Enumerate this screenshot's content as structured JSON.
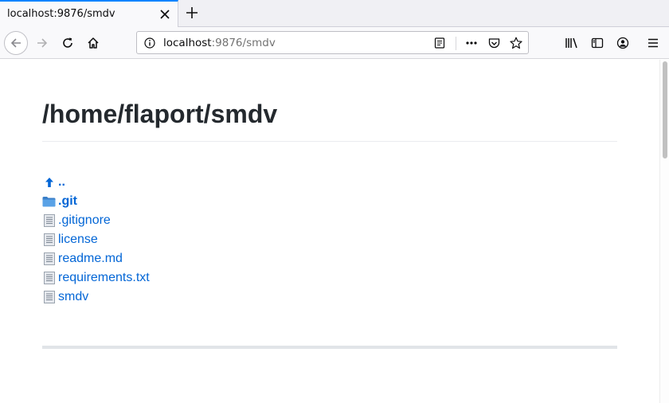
{
  "browser": {
    "tab": {
      "title": "localhost:9876/smdv",
      "close_icon": "close-icon"
    },
    "new_tab_icon": "plus-icon",
    "urlbar": {
      "host": "localhost",
      "rest": ":9876/smdv"
    }
  },
  "page": {
    "heading": "/home/flaport/smdv",
    "files": [
      {
        "icon": "up-arrow-icon",
        "label": "..",
        "bold": true
      },
      {
        "icon": "folder-icon",
        "label": ".git",
        "bold": true
      },
      {
        "icon": "file-icon",
        "label": ".gitignore",
        "bold": false
      },
      {
        "icon": "file-icon",
        "label": "license",
        "bold": false
      },
      {
        "icon": "file-icon",
        "label": "readme.md",
        "bold": false
      },
      {
        "icon": "file-icon",
        "label": "requirements.txt",
        "bold": false
      },
      {
        "icon": "file-icon",
        "label": "smdv",
        "bold": false
      }
    ]
  },
  "colors": {
    "link": "#0366d6",
    "accent": "#0a84ff",
    "heading": "#24292e"
  }
}
